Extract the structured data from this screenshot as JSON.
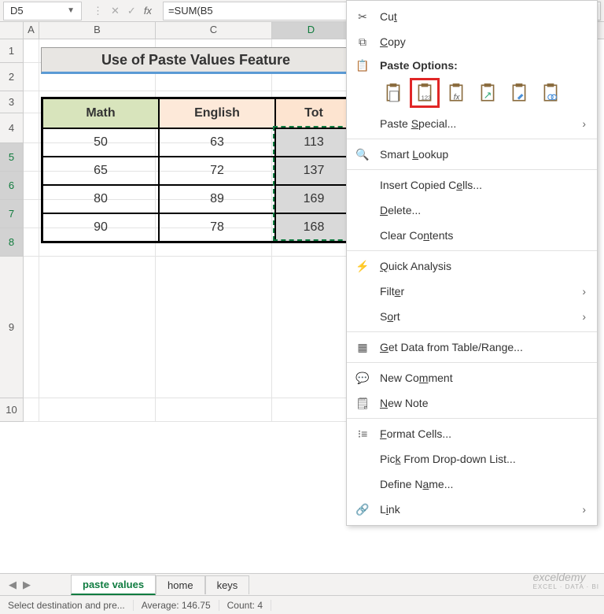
{
  "nameBox": "D5",
  "formula": "=SUM(B5",
  "columns": [
    "A",
    "B",
    "C",
    "D"
  ],
  "rowNumbers": [
    1,
    2,
    3,
    4,
    5,
    6,
    7,
    8,
    9,
    10
  ],
  "titleBand": "Use of Paste Values Feature",
  "headers": {
    "B": "Math",
    "C": "English",
    "D": "Tot"
  },
  "dataRows": [
    {
      "B": "50",
      "C": "63",
      "D": "113"
    },
    {
      "B": "65",
      "C": "72",
      "D": "137"
    },
    {
      "B": "80",
      "C": "89",
      "D": "169"
    },
    {
      "B": "90",
      "C": "78",
      "D": "168"
    }
  ],
  "menu": {
    "cut": "Cut",
    "copy": "Copy",
    "pasteOptionsHeader": "Paste Options:",
    "pasteIcons": [
      "paste",
      "paste-values",
      "paste-formulas",
      "paste-transpose",
      "paste-formatting",
      "paste-link"
    ],
    "pasteSpecial": "Paste Special...",
    "smartLookup": "Smart Lookup",
    "insertCopied": "Insert Copied Cells...",
    "delete": "Delete...",
    "clearContents": "Clear Contents",
    "quickAnalysis": "Quick Analysis",
    "filter": "Filter",
    "sort": "Sort",
    "getData": "Get Data from Table/Range...",
    "newComment": "New Comment",
    "newNote": "New Note",
    "formatCells": "Format Cells...",
    "pickList": "Pick From Drop-down List...",
    "defineName": "Define Name...",
    "link": "Link"
  },
  "tabs": {
    "active": "paste values",
    "others": [
      "home",
      "keys"
    ]
  },
  "status": {
    "msg": "Select destination and pre...",
    "avgLabel": "Average:",
    "avgVal": "146.75",
    "countLabel": "Count:",
    "countVal": "4"
  },
  "watermark": {
    "main": "exceldemy",
    "sub": "EXCEL · DATA · BI"
  }
}
